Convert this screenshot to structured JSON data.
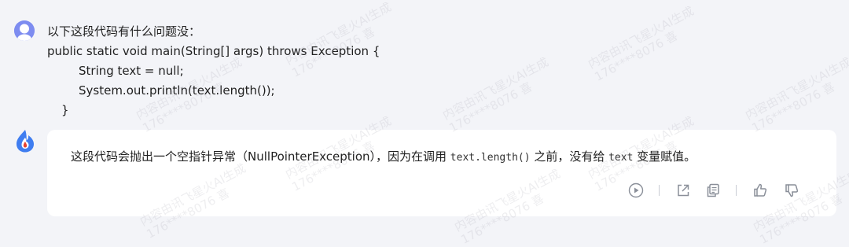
{
  "user": {
    "avatar_icon": "user-avatar-icon",
    "message_lines": [
      "以下这段代码有什么问题没：",
      "public static void main(String[] args) throws Exception {",
      "String text = null;",
      "System.out.println(text.length());",
      "}"
    ]
  },
  "assistant": {
    "avatar_icon": "spark-logo-icon",
    "reply_before": "这段代码会抛出一个空指针异常（NullPointerException），因为在调用 ",
    "reply_code1": "text.length()",
    "reply_middle": " 之前，没有给 ",
    "reply_code2": "text",
    "reply_after": " 变量赋值。",
    "actions": [
      "play-icon",
      "share-icon",
      "copy-icon",
      "thumbs-up-icon",
      "thumbs-down-icon"
    ]
  },
  "watermark": {
    "line1": "内容由讯飞星火AI生成",
    "line2": "176****8076 喜"
  },
  "colors": {
    "background": "#f3f4f8",
    "card": "#ffffff",
    "avatar": "#7d8cf0",
    "logo_blue": "#3f7df0",
    "logo_red": "#e8422f"
  }
}
